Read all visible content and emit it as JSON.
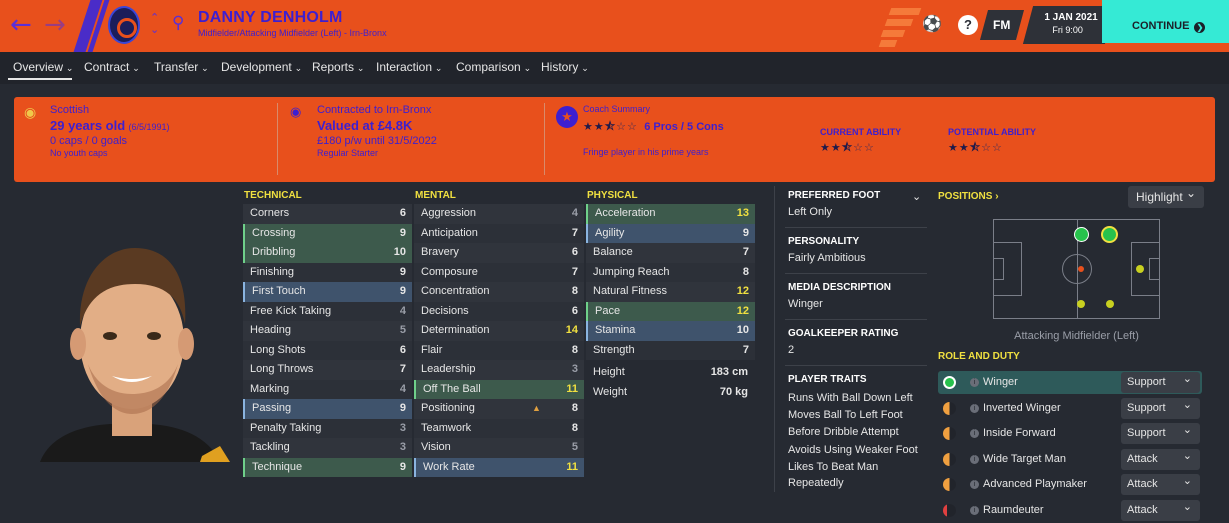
{
  "header": {
    "name": "DANNY DENHOLM",
    "subtitle": "Midfielder/Attacking Midfielder (Left) - Irn-Bronx",
    "date": "1 JAN 2021",
    "time": "Fri 9:00",
    "fm_label": "FM",
    "help": "?",
    "continue": "CONTINUE"
  },
  "menu": [
    "Overview",
    "Contract",
    "Transfer",
    "Development",
    "Reports",
    "Interaction",
    "Comparison",
    "History"
  ],
  "summary": {
    "nationality": "Scottish",
    "age": "29 years old",
    "dob": "(6/5/1991)",
    "caps": "0 caps / 0 goals",
    "youth_caps": "No youth caps",
    "contract_title": "Contracted to Irn-Bronx",
    "value": "Valued at £4.8K",
    "wage": "£180 p/w until 31/5/2022",
    "status": "Regular Starter",
    "coach_title": "Coach Summary",
    "pros_cons": "6 Pros / 5 Cons",
    "coach_note": "Fringe player in his prime years",
    "ca_label": "CURRENT ABILITY",
    "pa_label": "POTENTIAL ABILITY",
    "coach_stars": 2.5,
    "ca_stars": 2.5,
    "pa_stars": 2.5
  },
  "technical": {
    "title": "TECHNICAL",
    "rows": [
      [
        "Corners",
        "6"
      ],
      [
        "Crossing",
        "9"
      ],
      [
        "Dribbling",
        "10"
      ],
      [
        "Finishing",
        "9"
      ],
      [
        "First Touch",
        "9"
      ],
      [
        "Free Kick Taking",
        "4"
      ],
      [
        "Heading",
        "5"
      ],
      [
        "Long Shots",
        "6"
      ],
      [
        "Long Throws",
        "7"
      ],
      [
        "Marking",
        "4"
      ],
      [
        "Passing",
        "9"
      ],
      [
        "Penalty Taking",
        "3"
      ],
      [
        "Tackling",
        "3"
      ],
      [
        "Technique",
        "9"
      ]
    ]
  },
  "mental": {
    "title": "MENTAL",
    "rows": [
      [
        "Aggression",
        "4"
      ],
      [
        "Anticipation",
        "7"
      ],
      [
        "Bravery",
        "6"
      ],
      [
        "Composure",
        "7"
      ],
      [
        "Concentration",
        "8"
      ],
      [
        "Decisions",
        "6"
      ],
      [
        "Determination",
        "14"
      ],
      [
        "Flair",
        "8"
      ],
      [
        "Leadership",
        "3"
      ],
      [
        "Off The Ball",
        "11"
      ],
      [
        "Positioning",
        "8"
      ],
      [
        "Teamwork",
        "8"
      ],
      [
        "Vision",
        "5"
      ],
      [
        "Work Rate",
        "11"
      ]
    ]
  },
  "physical": {
    "title": "PHYSICAL",
    "rows": [
      [
        "Acceleration",
        "13"
      ],
      [
        "Agility",
        "9"
      ],
      [
        "Balance",
        "7"
      ],
      [
        "Jumping Reach",
        "8"
      ],
      [
        "Natural Fitness",
        "12"
      ],
      [
        "Pace",
        "12"
      ],
      [
        "Stamina",
        "10"
      ],
      [
        "Strength",
        "7"
      ]
    ],
    "height_label": "Height",
    "height": "183 cm",
    "weight_label": "Weight",
    "weight": "70 kg"
  },
  "info": {
    "foot_label": "PREFERRED FOOT",
    "foot": "Left Only",
    "personality_label": "PERSONALITY",
    "personality": "Fairly Ambitious",
    "media_label": "MEDIA DESCRIPTION",
    "media": "Winger",
    "gk_label": "GOALKEEPER RATING",
    "gk": "2",
    "traits_label": "PLAYER TRAITS",
    "traits": [
      "Runs With Ball Down Left",
      "Moves Ball To Left Foot",
      "Before Dribble Attempt",
      "Avoids Using Weaker Foot",
      "Likes To Beat Man",
      "Repeatedly"
    ]
  },
  "positions": {
    "title": "POSITIONS",
    "highlight": "Highlight",
    "caption": "Attacking Midfielder (Left)"
  },
  "roles": {
    "title": "ROLE AND DUTY",
    "items": [
      {
        "name": "Winger",
        "duty": "Support"
      },
      {
        "name": "Inverted Winger",
        "duty": "Support"
      },
      {
        "name": "Inside Forward",
        "duty": "Support"
      },
      {
        "name": "Wide Target Man",
        "duty": "Attack"
      },
      {
        "name": "Advanced Playmaker",
        "duty": "Attack"
      },
      {
        "name": "Raumdeuter",
        "duty": "Attack"
      }
    ]
  },
  "colors": {
    "accent": "#e8501c",
    "continue": "#35ead5",
    "highlight": "#f0e040",
    "natural": "#27c24c"
  }
}
